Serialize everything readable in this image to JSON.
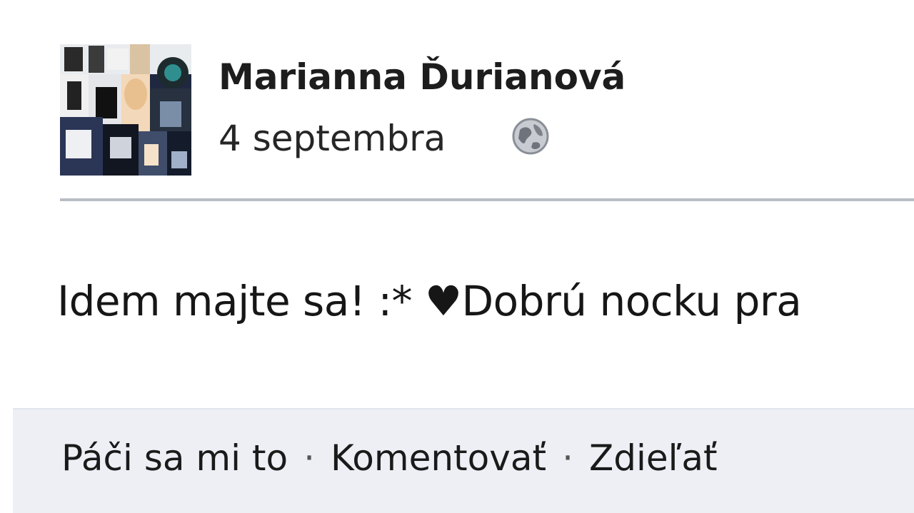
{
  "post": {
    "author": "Marianna Ďurianová",
    "date": "4 septembra",
    "privacy_icon": "globe-icon",
    "text": "Idem  majte sa! :* ♥Dobrú nocku pra",
    "actions": {
      "like": "Páči sa mi to",
      "comment": "Komentovať",
      "share": "Zdieľať",
      "separator": "·"
    }
  },
  "colors": {
    "action_bar_bg": "#edeff5",
    "divider": "#b8bcc4",
    "text": "#161616"
  }
}
